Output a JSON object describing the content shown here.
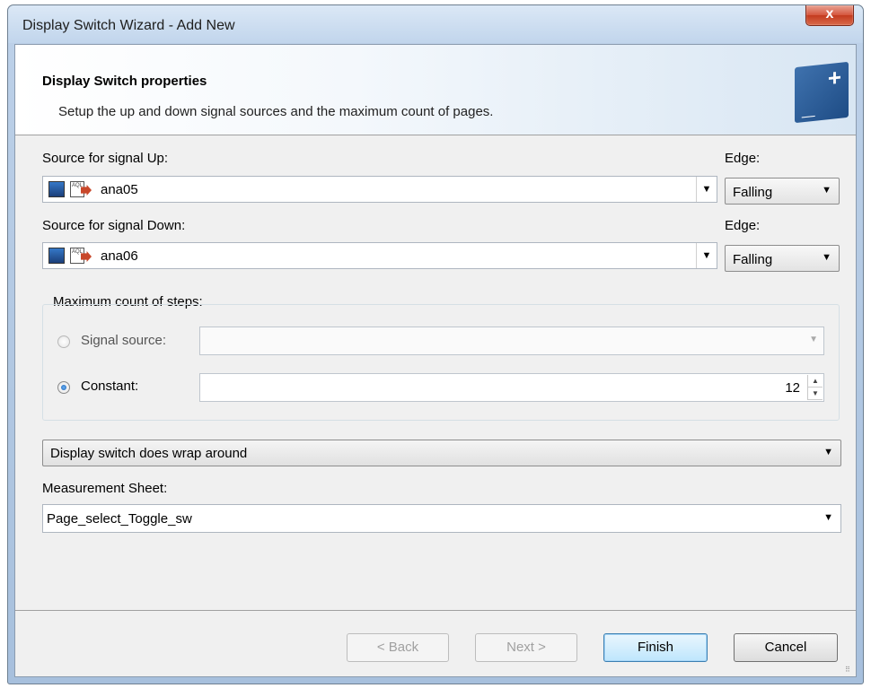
{
  "window": {
    "title": "Display Switch Wizard - Add New",
    "close_label": "x"
  },
  "header": {
    "title": "Display Switch properties",
    "subtitle": "Setup the up and down signal sources and the maximum count of pages.",
    "icon": "wizard-add-icon"
  },
  "signal_up": {
    "label": "Source for signal Up:",
    "value": "ana05",
    "edge_label": "Edge:",
    "edge_value": "Falling"
  },
  "signal_down": {
    "label": "Source for signal Down:",
    "value": "ana06",
    "edge_label": "Edge:",
    "edge_value": "Falling"
  },
  "steps": {
    "group_label": "Maximum count of steps:",
    "signal_source_label": "Signal source:",
    "signal_source_value": "",
    "constant_label": "Constant:",
    "constant_value": "12",
    "selected": "constant"
  },
  "wrap": {
    "value": "Display switch does wrap around"
  },
  "measurement": {
    "label": "Measurement Sheet:",
    "value": "Page_select_Toggle_sw"
  },
  "buttons": {
    "back": "< Back",
    "next": "Next >",
    "finish": "Finish",
    "cancel": "Cancel"
  },
  "icons": {
    "dropdown": "▼",
    "spin_up": "▲",
    "spin_down": "▼"
  }
}
